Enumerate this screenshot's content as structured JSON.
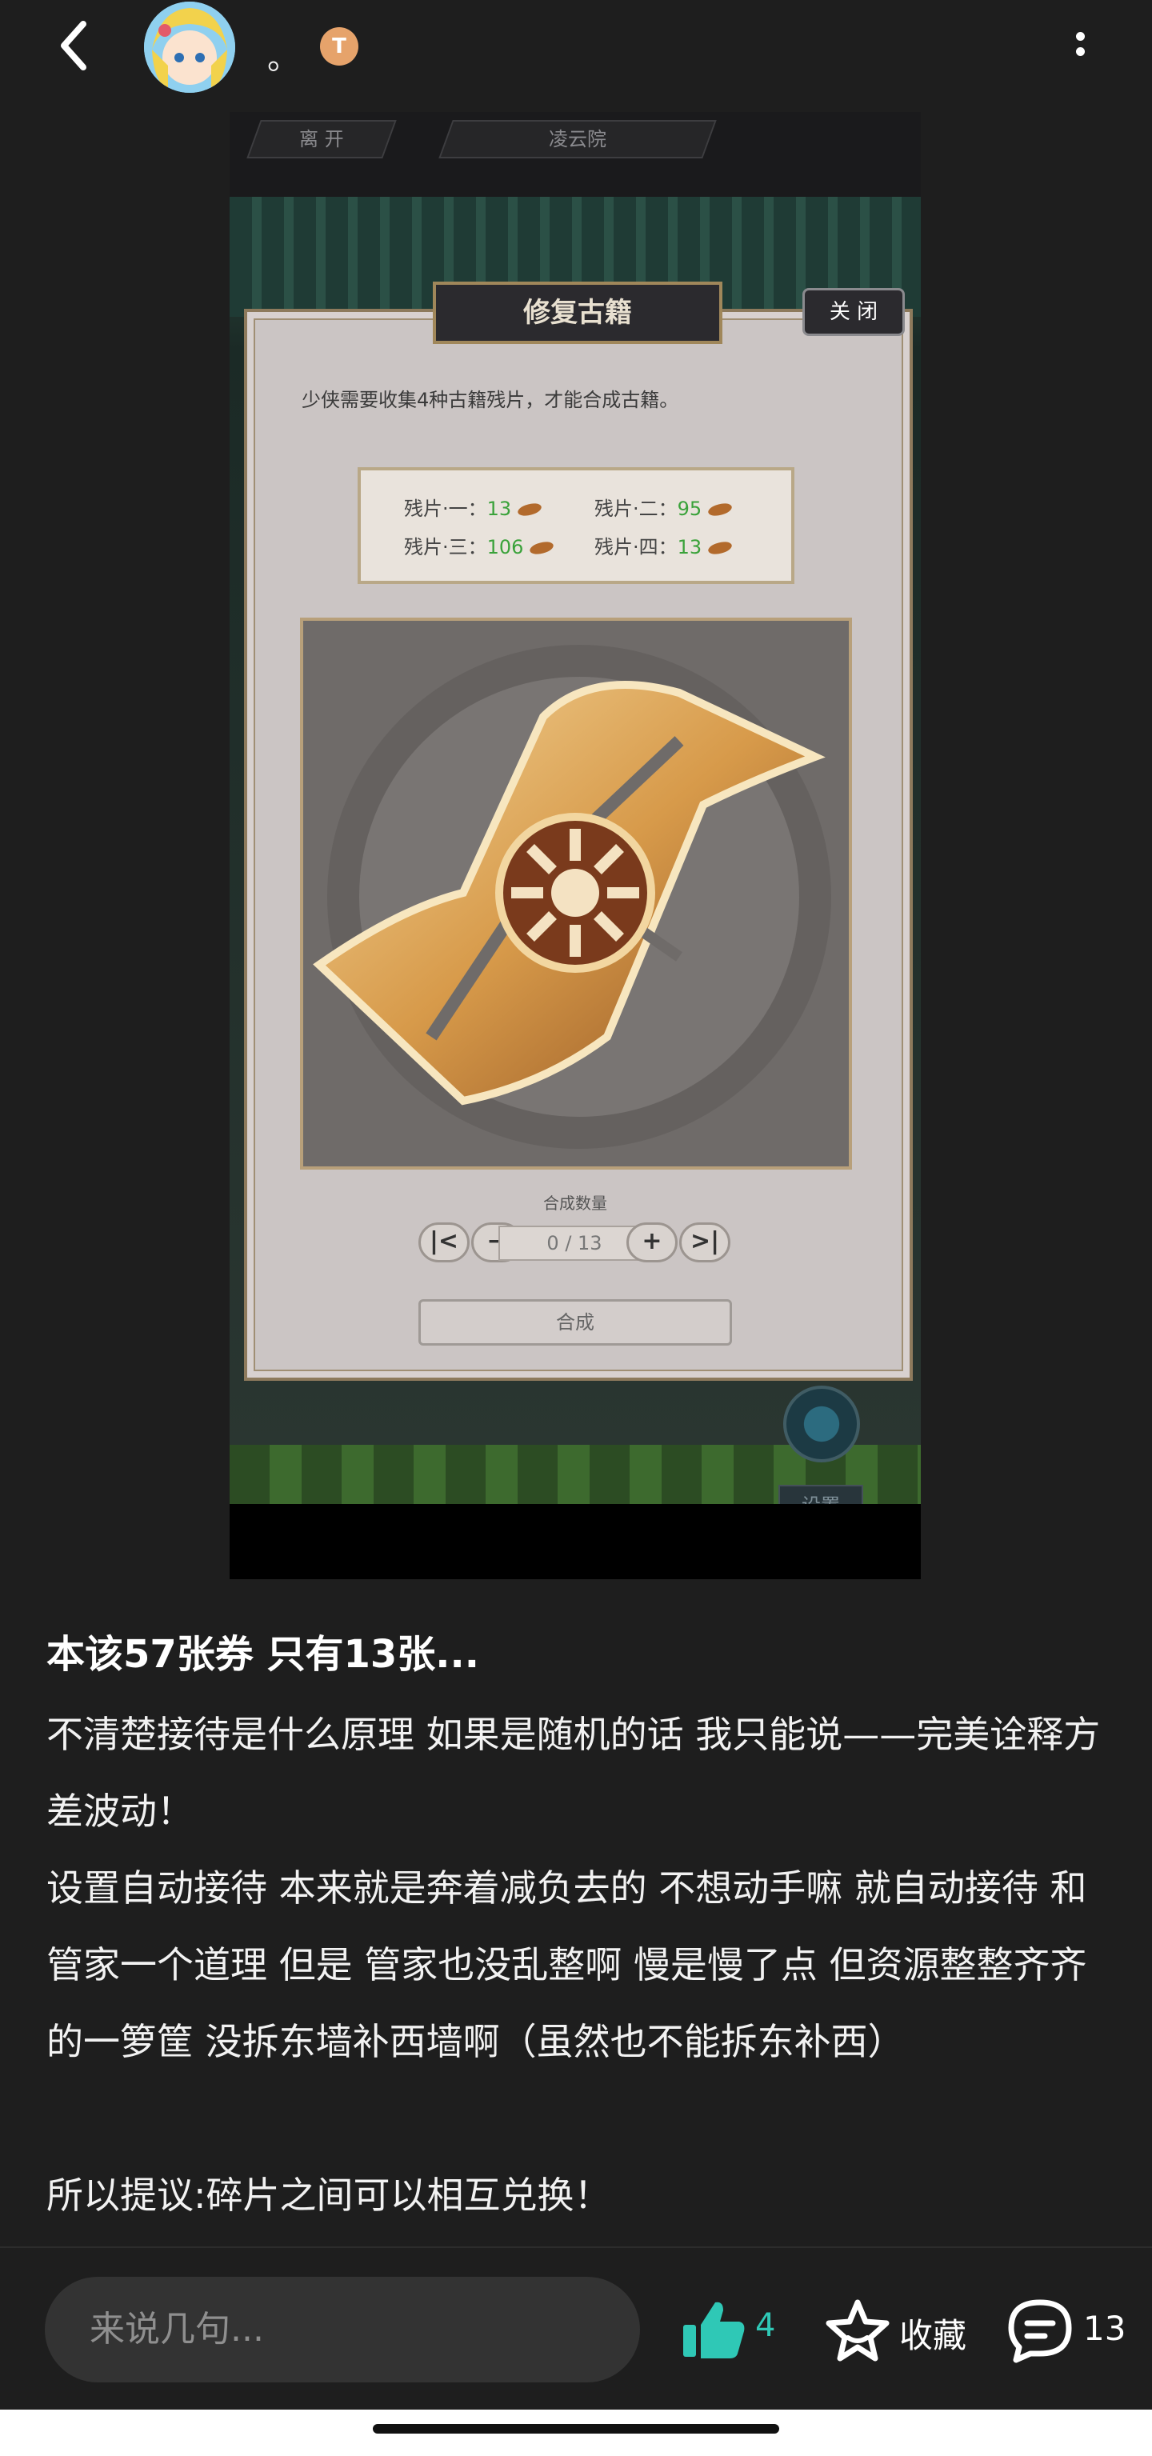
{
  "header": {
    "username": "。",
    "badge_text": "T"
  },
  "game": {
    "tab_leave": "离 开",
    "tab_location": "凌云院",
    "panel_title": "修复古籍",
    "close_label": "关 闭",
    "intro": "少侠需要收集4种古籍残片，才能合成古籍。",
    "fragments": [
      {
        "label": "残片·一：",
        "count": "13"
      },
      {
        "label": "残片·二：",
        "count": "95"
      },
      {
        "label": "残片·三：",
        "count": "106"
      },
      {
        "label": "残片·四：",
        "count": "13"
      }
    ],
    "qty_label": "合成数量",
    "qty_value": "0 / 13",
    "craft_label": "合成",
    "settings_label": "设置"
  },
  "post": {
    "title": "本该57张券 只有13张...",
    "paragraphs": [
      "不清楚接待是什么原理 如果是随机的话 我只能说——完美诠释方差波动！",
      "设置自动接待 本来就是奔着减负去的 不想动手嘛 就自动接待 和管家一个道理 但是 管家也没乱整啊 慢是慢了点 但资源整整齐齐的一箩筐 没拆东墙补西墙啊（虽然也不能拆东补西）",
      "所以提议:碎片之间可以相互兑换！"
    ]
  },
  "footer": {
    "comment_placeholder": "来说几句...",
    "like_count": "4",
    "favorite_label": "收藏",
    "comment_count": "13"
  },
  "colors": {
    "accent_like": "#2fc8b6",
    "background": "#1e1e1e"
  },
  "icons": [
    "back-icon",
    "more-icon",
    "thumbs-up-icon",
    "star-icon",
    "comment-icon"
  ]
}
